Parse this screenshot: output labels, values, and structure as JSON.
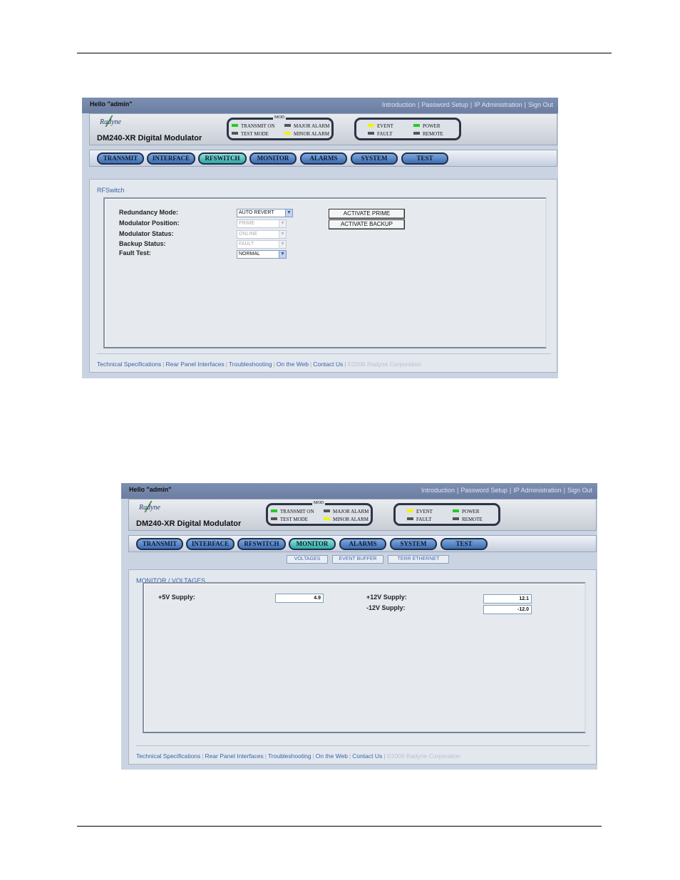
{
  "screens": [
    {
      "greeting": "Hello \"admin\"",
      "top_links": [
        "Introduction",
        "Password Setup",
        "IP Administration",
        "Sign Out"
      ],
      "logo_text": "Radyne",
      "product": "DM240-XR Digital Modulator",
      "mod_label": "MOD",
      "leds": {
        "transmit_on": "TRANSMIT ON",
        "test_mode": "TEST MODE",
        "major_alarm": "MAJOR ALARM",
        "minor_alarm": "MINOR ALARM",
        "event": "EVENT",
        "fault": "FAULT",
        "power": "POWER",
        "remote": "REMOTE"
      },
      "tabs": [
        "TRANSMIT",
        "INTERFACE",
        "RFSWITCH",
        "MONITOR",
        "ALARMS",
        "SYSTEM",
        "TEST"
      ],
      "active_tab": "RFSWITCH",
      "breadcrumb": "RFSwitch",
      "fields": [
        {
          "label": "Redundancy Mode:",
          "value": "AUTO REVERT",
          "enabled": true
        },
        {
          "label": "Modulator Position:",
          "value": "PRIME",
          "enabled": false
        },
        {
          "label": "Modulator Status:",
          "value": "ONLINE",
          "enabled": false
        },
        {
          "label": "Backup Status:",
          "value": "FAULT",
          "enabled": false
        },
        {
          "label": "Fault Test:",
          "value": "NORMAL",
          "enabled": true
        }
      ],
      "buttons": [
        "ACTIVATE PRIME",
        "ACTIVATE BACKUP"
      ],
      "footer_links": [
        "Technical Specifications",
        "Rear Panel Interfaces",
        "Troubleshooting",
        "On the Web",
        "Contact Us"
      ],
      "copyright": "©2006 Radyne Corporation"
    },
    {
      "greeting": "Hello \"admin\"",
      "top_links": [
        "Introduction",
        "Password Setup",
        "IP Administration",
        "Sign Out"
      ],
      "logo_text": "Radyne",
      "product": "DM240-XR Digital Modulator",
      "mod_label": "MOD",
      "leds": {
        "transmit_on": "TRANSMIT ON",
        "test_mode": "TEST MODE",
        "major_alarm": "MAJOR ALARM",
        "minor_alarm": "MINOR ALARM",
        "event": "EVENT",
        "fault": "FAULT",
        "power": "POWER",
        "remote": "REMOTE"
      },
      "tabs": [
        "TRANSMIT",
        "INTERFACE",
        "RFSWITCH",
        "MONITOR",
        "ALARMS",
        "SYSTEM",
        "TEST"
      ],
      "active_tab": "MONITOR",
      "subtabs": [
        "VOLTAGES",
        "EVENT BUFFER",
        "TERR ETHERNET"
      ],
      "breadcrumb": "MONITOR / VOLTAGES",
      "supplies": [
        {
          "label": "+5V Supply:",
          "value": "4.9"
        },
        {
          "label": "+12V Supply:",
          "value": "12.1"
        },
        {
          "label": "-12V Supply:",
          "value": "-12.0"
        }
      ],
      "footer_links": [
        "Technical Specifications",
        "Rear Panel Interfaces",
        "Troubleshooting",
        "On the Web",
        "Contact Us"
      ],
      "copyright": "©2006 Radyne Corporation"
    }
  ],
  "colors": {
    "tab_inactive": "#3e6db0",
    "tab_active": "#2fa9a0",
    "led_green": "#22cc22",
    "led_yellow": "#f2f200",
    "led_off": "#555555",
    "link": "#3a62a8"
  }
}
